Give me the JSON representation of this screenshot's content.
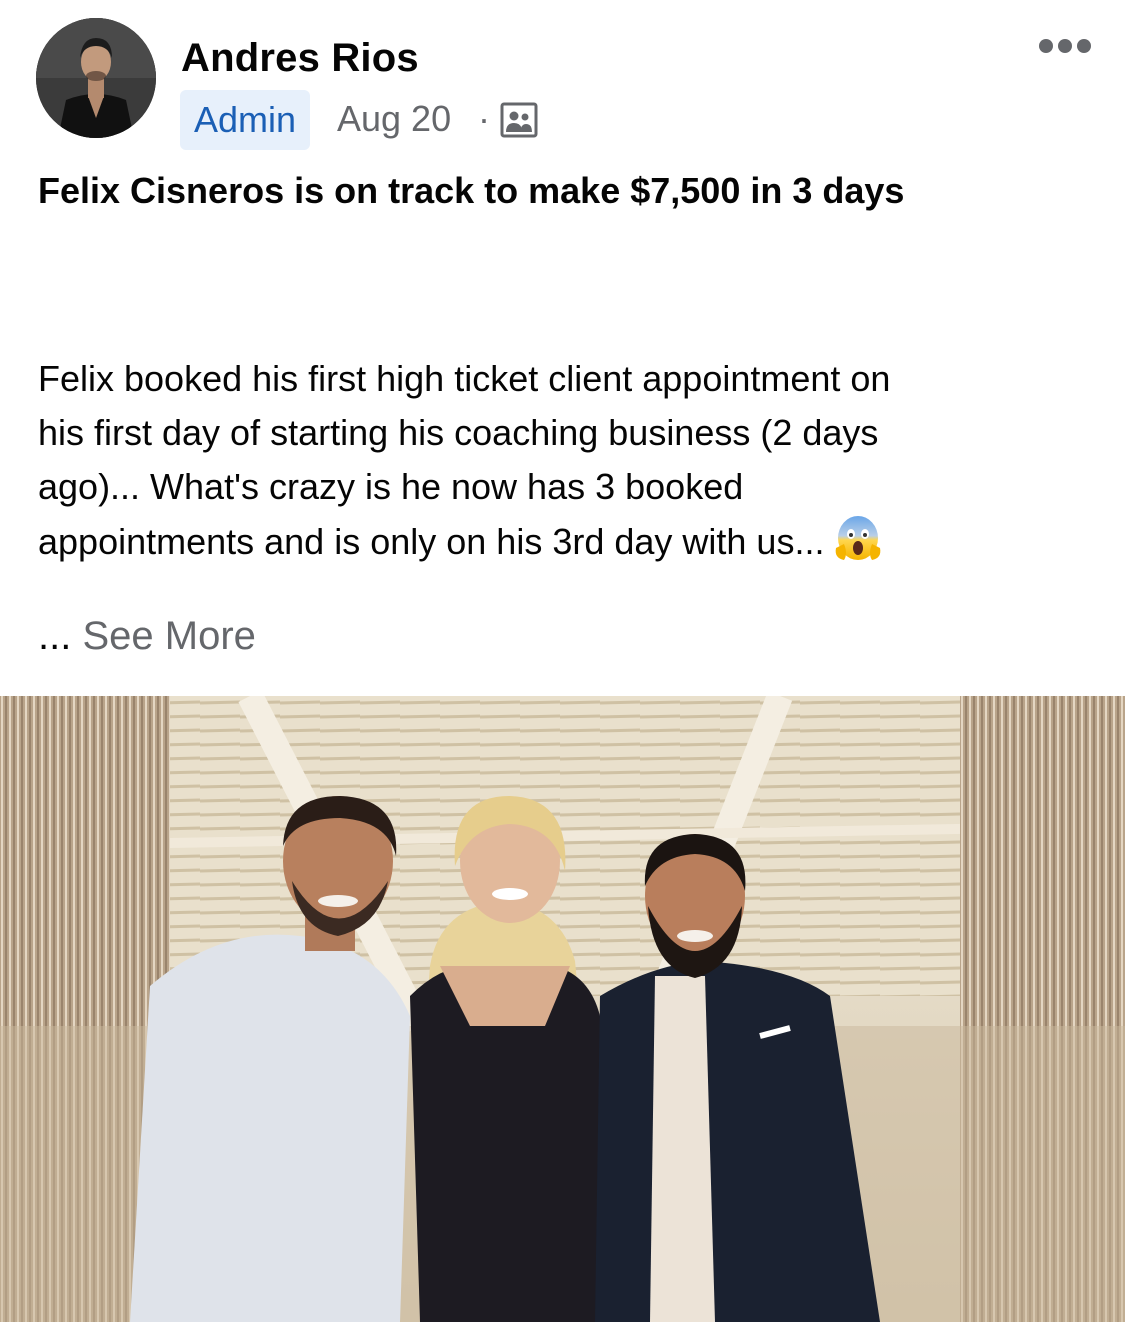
{
  "post": {
    "author": {
      "name": "Andres Rios",
      "role_badge": "Admin",
      "avatar_icon": "profile-photo"
    },
    "date": "Aug 20",
    "separator": "·",
    "audience_icon": "group-audience-icon",
    "more_icon": "more-options-icon",
    "title": "Felix Cisneros is on track to make $7,500 in 3 days",
    "body_lines": [
      "Felix booked his first high ticket client appointment on",
      "his first day of starting his coaching business (2 days",
      "ago)... What's crazy is he now has 3 booked",
      "appointments and is only on his 3rd day with us..."
    ],
    "body_emoji": "face-screaming-in-fear-emoji",
    "see_more_ellipsis": "...",
    "see_more_label": "See More",
    "photo": "group-photo-three-people"
  },
  "colors": {
    "admin_badge_bg": "#e7f0fb",
    "admin_badge_text": "#1b5fb5",
    "secondary_text": "#65676b",
    "primary_text": "#050505"
  }
}
